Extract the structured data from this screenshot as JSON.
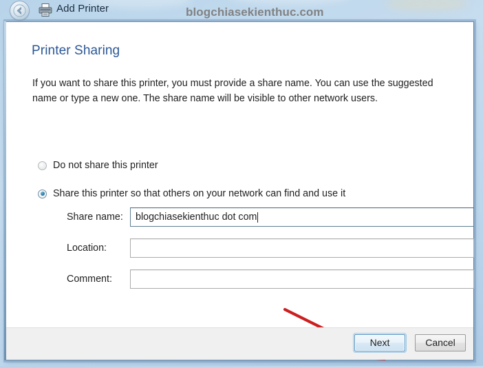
{
  "window": {
    "title": "Add Printer",
    "back_icon": "back-arrow-circle-icon",
    "app_icon": "printer-icon"
  },
  "watermark": {
    "text": "blogchiasekienthuc.com",
    "color": "#7f7f7f"
  },
  "page": {
    "heading": "Printer Sharing",
    "heading_color": "#2b5795",
    "intro": "If you want to share this printer, you must provide a share name. You can use the suggested name or type a new one. The share name will be visible to other network users."
  },
  "options": {
    "selected": "share",
    "items": [
      {
        "id": "noshare",
        "label": "Do not share this printer",
        "checked": false
      },
      {
        "id": "share",
        "label": "Share this printer so that others on your network can find and use it",
        "checked": true
      }
    ]
  },
  "fields": [
    {
      "id": "share-name",
      "label": "Share name:",
      "value": "blogchiasekienthuc dot com",
      "placeholder": "",
      "focused": true
    },
    {
      "id": "location",
      "label": "Location:",
      "value": "",
      "placeholder": "",
      "focused": false
    },
    {
      "id": "comment",
      "label": "Comment:",
      "value": "",
      "placeholder": "",
      "focused": false
    }
  ],
  "footer": {
    "next_label": "Next",
    "cancel_label": "Cancel"
  },
  "annotation": {
    "type": "arrow",
    "color": "#cc1f1f",
    "points_to": "next-button"
  }
}
